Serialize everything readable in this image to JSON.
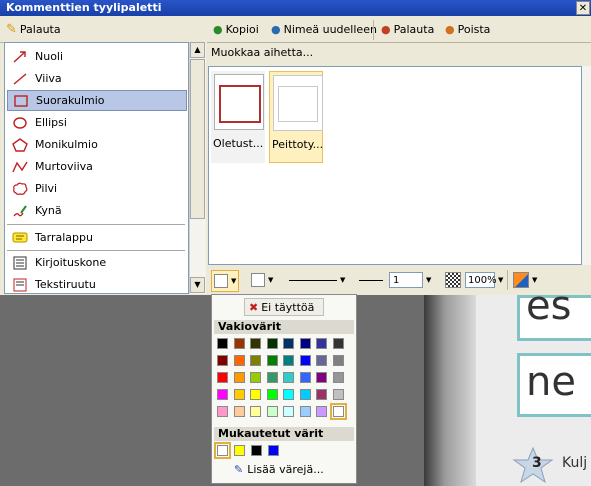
{
  "window": {
    "title": "Kommenttien tyylipaletti"
  },
  "left_toolbar": {
    "restore": "Palauta"
  },
  "tools": [
    {
      "label": "Nuoli",
      "icon": "arrow-icon"
    },
    {
      "label": "Viiva",
      "icon": "line-icon"
    },
    {
      "label": "Suorakulmio",
      "icon": "rectangle-icon",
      "selected": true
    },
    {
      "label": "Ellipsi",
      "icon": "ellipse-icon"
    },
    {
      "label": "Monikulmio",
      "icon": "polygon-icon"
    },
    {
      "label": "Murtoviiva",
      "icon": "polyline-icon"
    },
    {
      "label": "Pilvi",
      "icon": "cloud-icon"
    },
    {
      "label": "Kynä",
      "icon": "pencil-icon"
    },
    {
      "label": "Tarralappu",
      "icon": "sticky-note-icon"
    },
    {
      "label": "Kirjoituskone",
      "icon": "typewriter-icon"
    },
    {
      "label": "Tekstiruutu",
      "icon": "textbox-icon"
    }
  ],
  "right_toolbar": {
    "copy": "Kopioi",
    "rename": "Nimeä uudelleen",
    "restore": "Palauta",
    "delete": "Poista"
  },
  "edit_label": "Muokkaa aihetta...",
  "styles": [
    {
      "caption": "Oletust...",
      "border": "#b03030"
    },
    {
      "caption": "Peittoty...",
      "border": "#c8c8c8"
    }
  ],
  "props": {
    "line_width": "1",
    "opacity": "100%"
  },
  "color_popup": {
    "no_fill": "Ei täyttöä",
    "standard_title": "Vakiovärit",
    "custom_title": "Mukautetut värit",
    "more_colors": "Lisää värejä...",
    "standard_colors": [
      [
        "#000000",
        "#993300",
        "#333300",
        "#003300",
        "#003366",
        "#000080",
        "#333399",
        "#333333"
      ],
      [
        "#800000",
        "#ff6600",
        "#808000",
        "#008000",
        "#008080",
        "#0000ff",
        "#666699",
        "#808080"
      ],
      [
        "#ff0000",
        "#ff9900",
        "#99cc00",
        "#339966",
        "#33cccc",
        "#3366ff",
        "#800080",
        "#969696"
      ],
      [
        "#ff00ff",
        "#ffcc00",
        "#ffff00",
        "#00ff00",
        "#00ffff",
        "#00ccff",
        "#993366",
        "#c0c0c0"
      ],
      [
        "#ff99cc",
        "#ffcc99",
        "#ffff99",
        "#ccffcc",
        "#ccffff",
        "#99ccff",
        "#cc99ff",
        "#ffffff"
      ]
    ],
    "custom_colors": [
      "#ffffff",
      "#ffff00",
      "#000000",
      "#0000ff"
    ]
  },
  "background_doc": {
    "text1": "es",
    "text2": "ne",
    "badge": "3",
    "caption": "Kulj"
  }
}
